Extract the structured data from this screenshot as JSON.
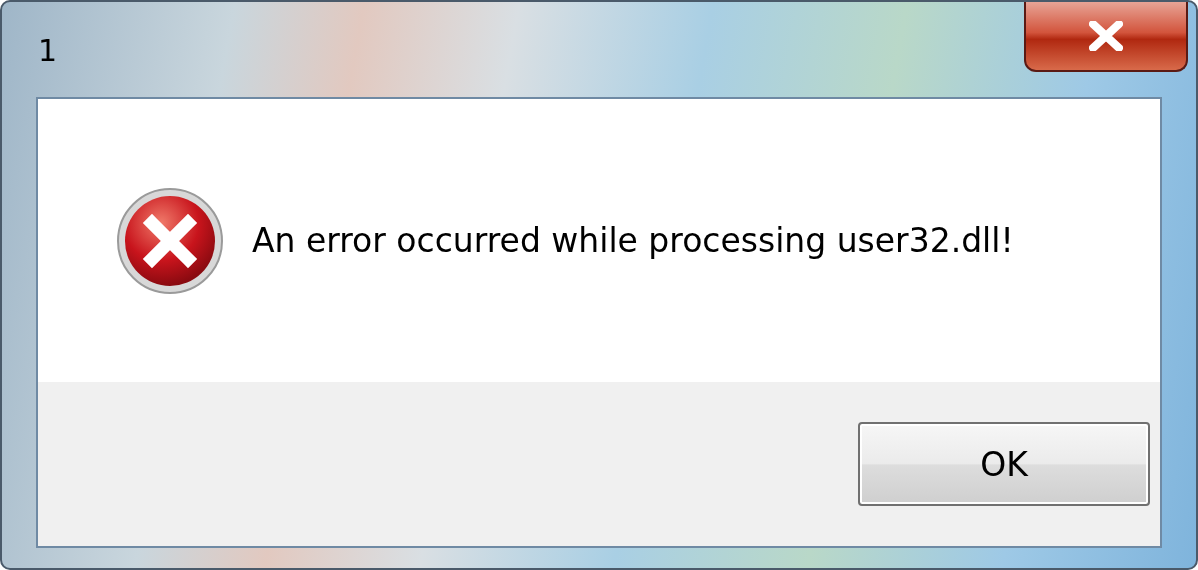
{
  "window": {
    "title": "1"
  },
  "message": "An error occurred while processing user32.dll!",
  "buttons": [
    {
      "label": "OK"
    }
  ]
}
